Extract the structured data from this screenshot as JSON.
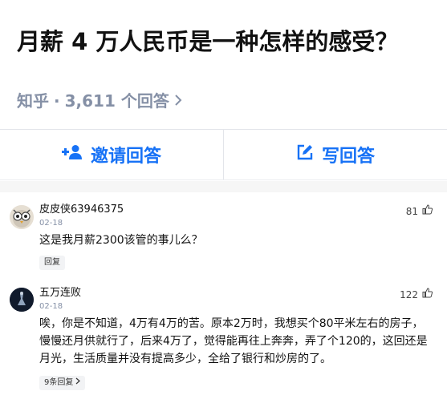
{
  "question": {
    "title": "月薪 4 万人民币是一种怎样的感受？",
    "source": "知乎",
    "separator": "·",
    "answers_count": "3,611 个回答",
    "chevron_icon": "chevron-right-icon"
  },
  "actions": {
    "invite_label": "邀请回答",
    "invite_icon": "add-user-icon",
    "write_label": "写回答",
    "write_icon": "edit-icon"
  },
  "comments": [
    {
      "author": "皮皮侠63946375",
      "date": "02-18",
      "likes": "81",
      "text": "这是我月薪2300该管的事儿么？",
      "reply_label": "回复",
      "avatar_icon": "owl-avatar-icon"
    },
    {
      "author": "五万连败",
      "date": "02-18",
      "likes": "122",
      "text": "唉，你是不知道，4万有4万的苦。原本2万时，我想买个80平米左右的房子，慢慢还月供就行了，后来4万了，觉得能再往上奔奔，弄了个120的，这回还是月光，生活质量并没有提高多少，全给了银行和炒房的了。",
      "reply_label": "9条回复",
      "avatar_icon": "dark-avatar-icon"
    }
  ],
  "colors": {
    "accent": "#1772f6",
    "muted": "#8590a6",
    "text": "#121212"
  }
}
